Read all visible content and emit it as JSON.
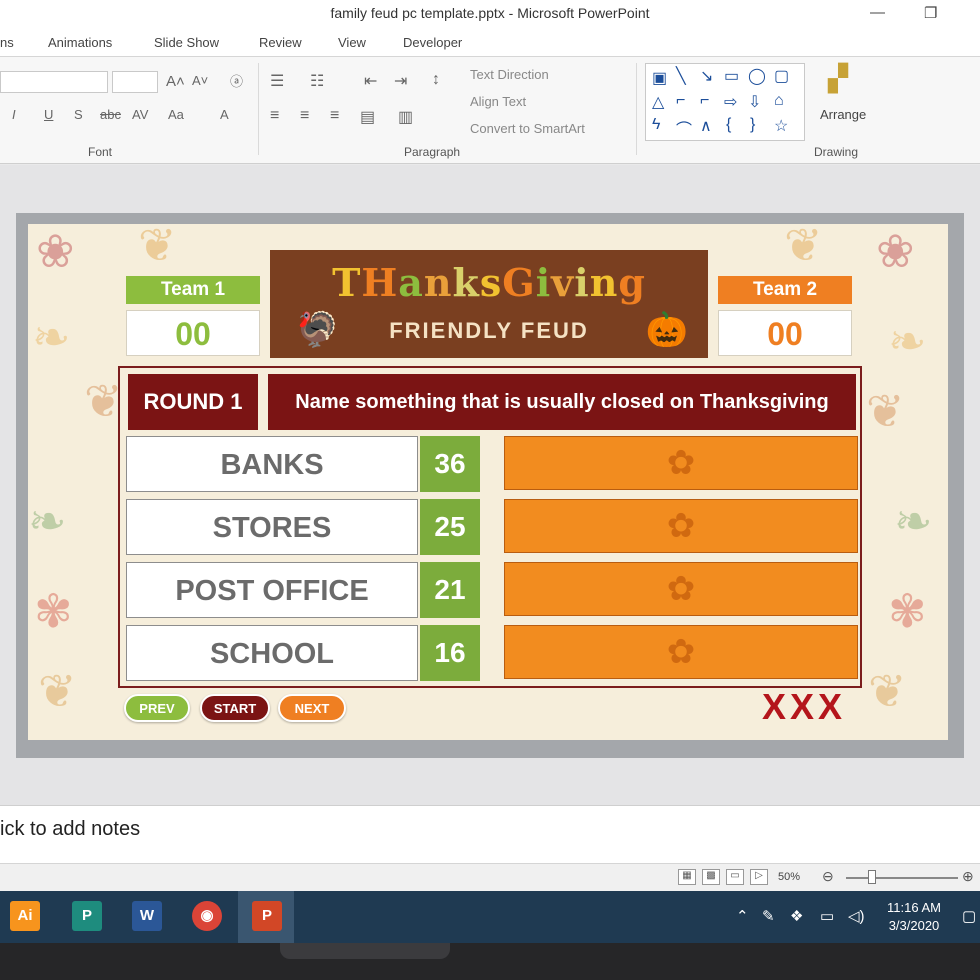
{
  "window": {
    "title": "family feud pc template.pptx  -  Microsoft PowerPoint",
    "minimize_glyph": "—",
    "restore_glyph": "❐"
  },
  "ribbon_tabs": [
    "ns",
    "Animations",
    "Slide Show",
    "Review",
    "View",
    "Developer"
  ],
  "ribbon": {
    "font_group_label": "Font",
    "paragraph_group_label": "Paragraph",
    "drawing_group_label": "Drawing",
    "text_direction": "Text Direction",
    "align_text": "Align Text",
    "convert_smartart": "Convert to SmartArt",
    "arrange": "Arrange"
  },
  "slide": {
    "team1": {
      "label": "Team 1",
      "score": "00",
      "color": "#8dbd3e"
    },
    "team2": {
      "label": "Team 2",
      "score": "00",
      "color": "#ef7f22"
    },
    "banner": {
      "title": "THanksGiving",
      "subtitle": "FRIENDLY FEUD"
    },
    "round": "ROUND 1",
    "question": "Name something that is usually closed on Thanksgiving",
    "answers": [
      {
        "text": "BANKS",
        "points": "36"
      },
      {
        "text": "STORES",
        "points": "25"
      },
      {
        "text": "POST OFFICE",
        "points": "21"
      },
      {
        "text": "SCHOOL",
        "points": "16"
      }
    ],
    "buttons": {
      "prev": "PREV",
      "start": "START",
      "next": "NEXT"
    },
    "strikes": "XXX"
  },
  "notes_placeholder": "ick to add notes",
  "status": {
    "zoom": "50%"
  },
  "taskbar": {
    "apps": [
      {
        "name": "illustrator-icon",
        "label": "Ai",
        "color": "#f7941d"
      },
      {
        "name": "publisher-icon",
        "label": "P",
        "color": "#1e8c7e"
      },
      {
        "name": "word-icon",
        "label": "W",
        "color": "#2b5797"
      },
      {
        "name": "chrome-icon",
        "label": "◉",
        "color": "#db4437"
      },
      {
        "name": "powerpoint-icon",
        "label": "P",
        "color": "#d24726"
      }
    ],
    "time": "11:16 AM",
    "date": "3/3/2020"
  }
}
